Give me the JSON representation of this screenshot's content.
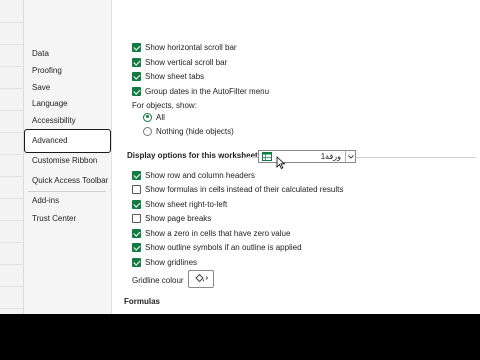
{
  "sidebar": {
    "items": [
      {
        "label": "Data"
      },
      {
        "label": "Proofing"
      },
      {
        "label": "Save"
      },
      {
        "label": "Language"
      },
      {
        "label": "Accessibility"
      },
      {
        "label": "Advanced",
        "active": true
      },
      {
        "label": "Customise Ribbon"
      },
      {
        "label": "Quick Access Toolbar"
      },
      {
        "label": "Add-ins"
      },
      {
        "label": "Trust Center"
      }
    ]
  },
  "display": {
    "show_horizontal_scroll_bar": {
      "label": "Show horizontal scroll bar",
      "checked": true
    },
    "show_vertical_scroll_bar": {
      "label": "Show vertical scroll bar",
      "checked": true
    },
    "show_sheet_tabs": {
      "label": "Show sheet tabs",
      "checked": true
    },
    "group_dates": {
      "label": "Group dates in the AutoFilter menu",
      "checked": true
    },
    "for_objects_show": "For objects, show:",
    "objects_all": {
      "label": "All",
      "selected": true
    },
    "objects_nothing": {
      "label": "Nothing (hide objects)",
      "selected": false
    }
  },
  "worksheet": {
    "heading": "Display options for this worksheet:",
    "selected_sheet": "ورقة1",
    "options": {
      "row_column_headers": {
        "label": "Show row and column headers",
        "checked": true
      },
      "formulas_in_cells": {
        "label": "Show formulas in cells instead of their calculated results",
        "checked": false
      },
      "right_to_left": {
        "label": "Show sheet right-to-left",
        "checked": true
      },
      "page_breaks": {
        "label": "Show page breaks",
        "checked": false
      },
      "zero_in_cells": {
        "label": "Show a zero in cells that have zero value",
        "checked": true
      },
      "outline_symbols": {
        "label": "Show outline symbols if an outline is applied",
        "checked": true
      },
      "gridlines": {
        "label": "Show gridlines",
        "checked": true
      }
    },
    "gridline_colour_label": "Gridline colour"
  },
  "formulas_heading": "Formulas",
  "colors": {
    "accent": "#107c41",
    "sidebar_bg": "#f5f5f5",
    "background": "#ffffff"
  },
  "icons": {
    "sheet": "sheet-icon",
    "dropdown": "chevron-down-icon",
    "paint_bucket": "paint-bucket-icon",
    "cursor": "mouse-cursor-icon"
  }
}
